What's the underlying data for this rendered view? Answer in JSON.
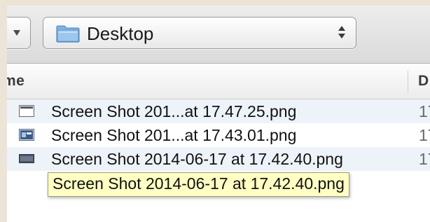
{
  "path_select": {
    "label": "Desktop"
  },
  "columns": {
    "name": "me",
    "date": "D"
  },
  "files": [
    {
      "name": "Screen Shot 201...at 17.47.25.png",
      "date": "17"
    },
    {
      "name": "Screen Shot 201...at 17.43.01.png",
      "date": "17"
    },
    {
      "name": "Screen Shot 2014-06-17 at 17.42.40.png",
      "date": "17"
    }
  ],
  "tooltip": {
    "text": "Screen Shot 2014-06-17 at 17.42.40.png"
  },
  "icons": {
    "view": "chevron-down-icon",
    "folder": "folder-icon",
    "stepper": "up-down-arrows-icon",
    "file": "image-file-icon"
  },
  "colors": {
    "tooltip_bg": "#ffffc4",
    "alt_row": "#eef3fa",
    "folder_blue": "#5d9bd6"
  }
}
